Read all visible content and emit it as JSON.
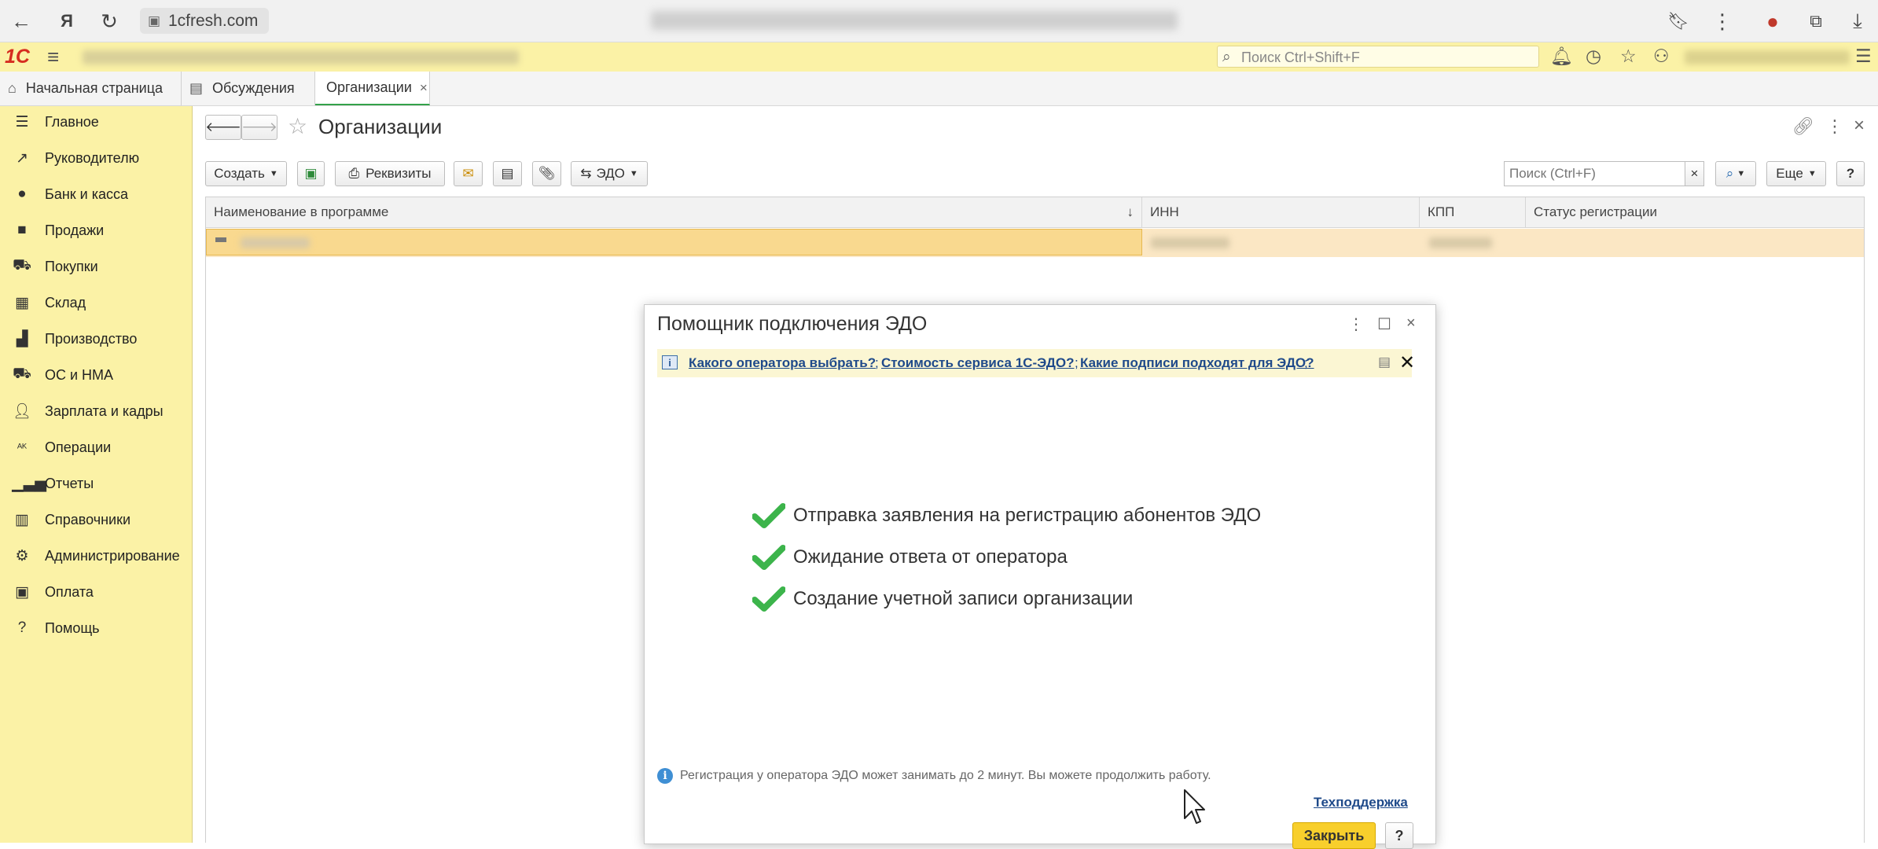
{
  "browser": {
    "url": "1cfresh.com"
  },
  "header": {
    "logo": "1С",
    "search_placeholder": "Поиск Ctrl+Shift+F"
  },
  "tabs": [
    {
      "label": "Начальная страница",
      "icon": "home-icon"
    },
    {
      "label": "Обсуждения",
      "icon": "chat-icon"
    },
    {
      "label": "Организации",
      "icon": "",
      "active": true,
      "closable": true
    }
  ],
  "sidebar": {
    "items": [
      {
        "label": "Главное",
        "icon": "menu-lines-icon"
      },
      {
        "label": "Руководителю",
        "icon": "trend-icon"
      },
      {
        "label": "Банк и касса",
        "icon": "ruble-coin-icon"
      },
      {
        "label": "Продажи",
        "icon": "bag-icon"
      },
      {
        "label": "Покупки",
        "icon": "cart-icon"
      },
      {
        "label": "Склад",
        "icon": "warehouse-icon"
      },
      {
        "label": "Производство",
        "icon": "factory-icon"
      },
      {
        "label": "ОС и НМА",
        "icon": "truck-icon"
      },
      {
        "label": "Зарплата и кадры",
        "icon": "person-icon"
      },
      {
        "label": "Операции",
        "icon": "operations-icon"
      },
      {
        "label": "Отчеты",
        "icon": "bar-chart-icon"
      },
      {
        "label": "Справочники",
        "icon": "books-icon"
      },
      {
        "label": "Администрирование",
        "icon": "gear-icon"
      },
      {
        "label": "Оплата",
        "icon": "payment-icon"
      },
      {
        "label": "Помощь",
        "icon": "question-icon"
      }
    ]
  },
  "form": {
    "title": "Организации",
    "toolbar": {
      "create": "Создать",
      "requisites": "Реквизиты",
      "edo": "ЭДО",
      "search_placeholder": "Поиск (Ctrl+F)",
      "more": "Еще",
      "help": "?"
    },
    "table": {
      "columns": [
        "Наименование в программе",
        "ИНН",
        "КПП",
        "Статус регистрации"
      ],
      "sort_indicator": "↓"
    }
  },
  "dialog": {
    "title": "Помощник подключения ЭДО",
    "info_links": [
      "Какого оператора выбрать?",
      "Стоимость сервиса 1С-ЭДО?",
      "Какие подписи подходят для ЭДО?"
    ],
    "info_separator": ";",
    "steps": [
      "Отправка заявления на регистрацию абонентов ЭДО",
      "Ожидание ответа от оператора",
      "Создание учетной записи организации"
    ],
    "note": "Регистрация у оператора ЭДО может занимать до 2 минут. Вы можете продолжить работу.",
    "support_link": "Техподдержка",
    "close_button": "Закрыть",
    "help_button": "?"
  },
  "colors": {
    "accent_yellow": "#fbf2a6",
    "selection": "#f9d98f",
    "check_green": "#3cb44b",
    "link_blue": "#1f4a8a",
    "close_button": "#f8cf2c"
  }
}
